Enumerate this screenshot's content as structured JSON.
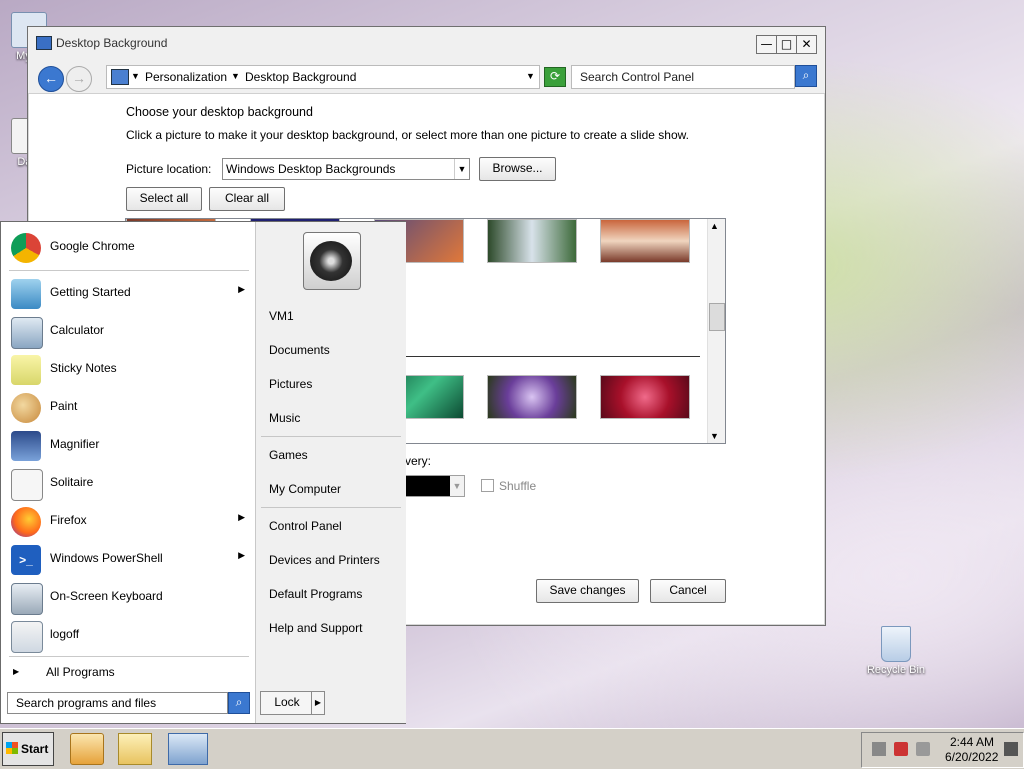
{
  "desktop": {
    "icons": [
      {
        "label": "My C"
      },
      {
        "label": "Data"
      },
      {
        "label": "Recycle Bin"
      }
    ]
  },
  "window": {
    "title": "Desktop Background",
    "buttons": {
      "minimize": "—",
      "maximize": "□",
      "close": "✕"
    },
    "breadcrumb": [
      "Personalization",
      "Desktop Background"
    ],
    "search_placeholder": "Search Control Panel",
    "heading": "Choose your desktop background",
    "instruction": "Click a picture to make it your desktop background, or select more than one picture to create a slide show.",
    "picture_location_label": "Picture location:",
    "picture_location_value": "Windows Desktop Backgrounds",
    "browse_label": "Browse...",
    "select_all_label": "Select all",
    "clear_all_label": "Clear all",
    "partial_label": "very:",
    "shuffle_label": "Shuffle",
    "save_label": "Save changes",
    "cancel_label": "Cancel"
  },
  "start_menu": {
    "pinned": [
      {
        "label": "Google Chrome",
        "icon": "chrome-icon"
      }
    ],
    "programs": [
      {
        "label": "Getting Started",
        "icon": "getting-started-icon",
        "submenu": true
      },
      {
        "label": "Calculator",
        "icon": "calculator-icon",
        "submenu": false
      },
      {
        "label": "Sticky Notes",
        "icon": "sticky-notes-icon",
        "submenu": false
      },
      {
        "label": "Paint",
        "icon": "paint-icon",
        "submenu": false
      },
      {
        "label": "Magnifier",
        "icon": "magnifier-icon",
        "submenu": false
      },
      {
        "label": "Solitaire",
        "icon": "solitaire-icon",
        "submenu": false
      },
      {
        "label": "Firefox",
        "icon": "firefox-icon",
        "submenu": true
      },
      {
        "label": "Windows PowerShell",
        "icon": "powershell-icon",
        "submenu": true
      },
      {
        "label": "On-Screen Keyboard",
        "icon": "keyboard-icon",
        "submenu": false
      },
      {
        "label": "logoff",
        "icon": "logoff-icon",
        "submenu": false
      }
    ],
    "all_programs": "All Programs",
    "search_placeholder": "Search programs and files",
    "right_items": [
      "VM1",
      "Documents",
      "Pictures",
      "Music",
      "Games",
      "My Computer",
      "Control Panel",
      "Devices and Printers",
      "Default Programs",
      "Help and Support"
    ],
    "lock_label": "Lock"
  },
  "taskbar": {
    "start_label": "Start",
    "time": "2:44 AM",
    "date": "6/20/2022"
  }
}
